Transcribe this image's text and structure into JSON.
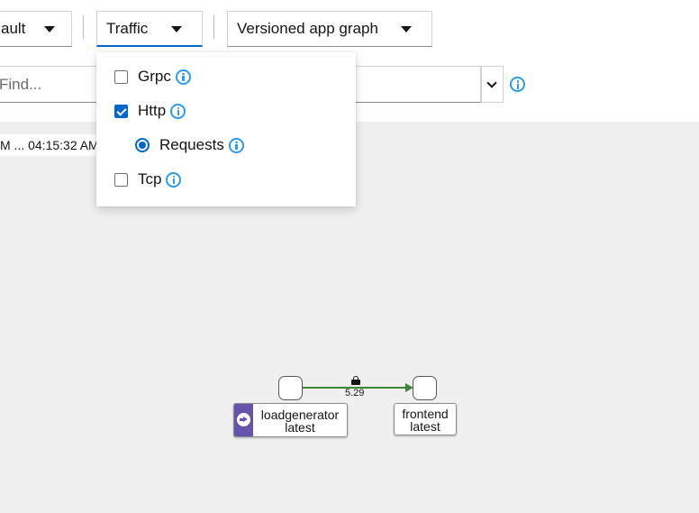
{
  "toolbar": {
    "namespace_select": {
      "label": "ault"
    },
    "traffic_select": {
      "label": "Traffic"
    },
    "graph_type_select": {
      "label": "Versioned app graph"
    },
    "find": {
      "placeholder": "Find..."
    }
  },
  "traffic_menu": {
    "items": [
      {
        "label": "Grpc",
        "type": "checkbox",
        "checked": false
      },
      {
        "label": "Http",
        "type": "checkbox",
        "checked": true
      },
      {
        "label": "Requests",
        "type": "radio",
        "checked": true
      },
      {
        "label": "Tcp",
        "type": "checkbox",
        "checked": false
      }
    ]
  },
  "graph": {
    "timestamp": "M ... 04:15:32 AM",
    "edge": {
      "label": "5.29",
      "color": "#3e8635"
    },
    "nodes": [
      {
        "name": "loadgenerator",
        "version": "latest",
        "badge_color": "#6753ac"
      },
      {
        "name": "frontend",
        "version": "latest"
      }
    ]
  },
  "colors": {
    "accent": "#06c",
    "info": "#2b9af3",
    "canvas": "#f0f0f0"
  },
  "icons": {
    "dropdown": "caret-down-icon",
    "find_toggle": "chevron-down-icon",
    "help": "info-circle-icon",
    "edge_security": "lock-icon",
    "node_badge": "arrow-circle-right-icon"
  }
}
